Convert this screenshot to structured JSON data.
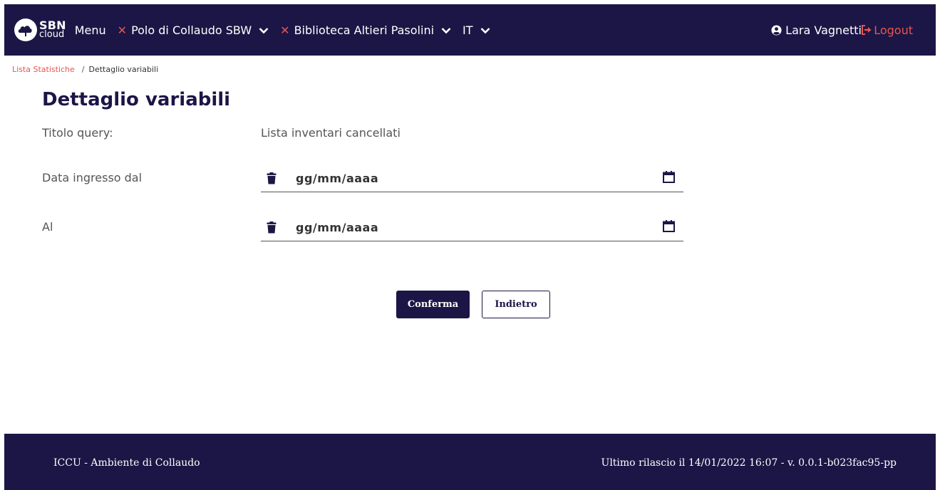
{
  "header": {
    "logo_line1": "SBN",
    "logo_line2": "cloud",
    "menu_label": "Menu",
    "polo_label": "Polo di Collaudo SBW",
    "biblioteca_label": "Biblioteca Altieri Pasolini",
    "language_label": "IT",
    "user_name": "Lara Vagnetti",
    "logout_label": "Logout"
  },
  "breadcrumb": {
    "parent": "Lista Statistiche",
    "separator": "/",
    "current": "Dettaglio variabili"
  },
  "page": {
    "title": "Dettaglio variabili",
    "query_title_label": "Titolo query:",
    "query_title_value": "Lista inventari cancellati",
    "date_from_label": "Data ingresso dal",
    "date_from_placeholder": "gg/mm/aaaa",
    "date_to_label": "Al",
    "date_to_placeholder": "gg/mm/aaaa"
  },
  "actions": {
    "confirm_label": "Conferma",
    "back_label": "Indietro"
  },
  "footer": {
    "environment": "ICCU - Ambiente di Collaudo",
    "release": "Ultimo rilascio il 14/01/2022 16:07 - v. 0.0.1-b023fac95-pp"
  },
  "colors": {
    "brand_dark": "#1c1646",
    "accent_red": "#e8554e"
  }
}
